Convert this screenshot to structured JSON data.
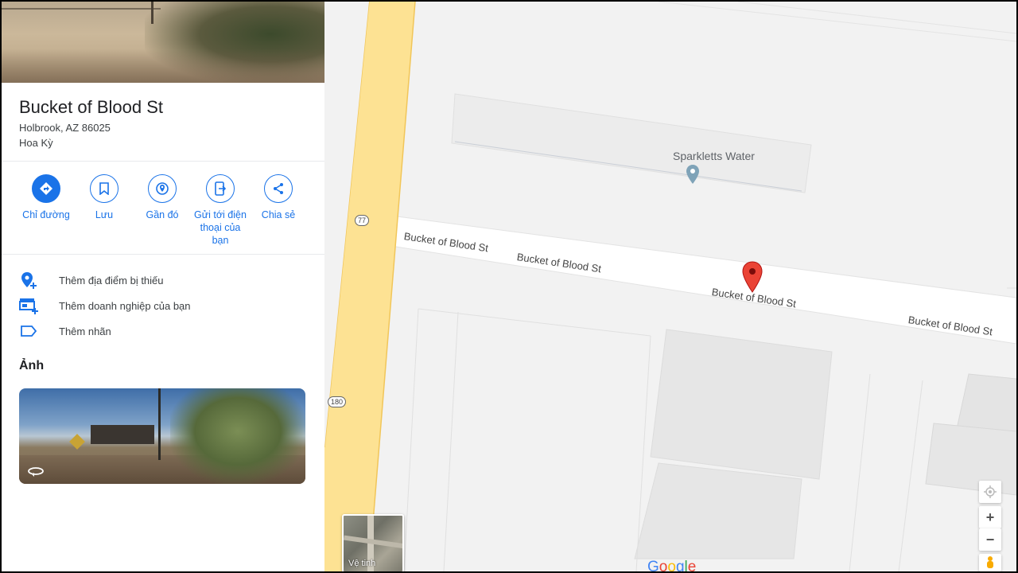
{
  "place": {
    "title": "Bucket of Blood St",
    "address_line1": "Holbrook, AZ 86025",
    "address_line2": "Hoa Kỳ"
  },
  "actions": [
    {
      "label": "Chỉ đường",
      "icon": "directions-icon"
    },
    {
      "label": "Lưu",
      "icon": "bookmark-icon"
    },
    {
      "label": "Gần đó",
      "icon": "nearby-icon"
    },
    {
      "label": "Gửi tới điện thoại của bạn",
      "icon": "send-to-phone-icon"
    },
    {
      "label": "Chia sẻ",
      "icon": "share-icon"
    }
  ],
  "rows": [
    {
      "label": "Thêm địa điểm bị thiếu",
      "icon": "add-location-icon"
    },
    {
      "label": "Thêm doanh nghiệp của bạn",
      "icon": "add-business-icon"
    },
    {
      "label": "Thêm nhãn",
      "icon": "label-icon"
    }
  ],
  "photos_heading": "Ảnh",
  "map": {
    "road_labels": [
      "Bucket of Blood St",
      "Bucket of Blood St",
      "Bucket of Blood St",
      "Bucket of Blood St"
    ],
    "poi_label": "Sparkletts Water",
    "shield_77": "77",
    "shield_180": "180",
    "satellite_label": "Vệ tinh",
    "logo": "Google",
    "zoom_in": "+",
    "zoom_out": "−"
  },
  "colors": {
    "accent": "#1a73e8",
    "highway": "#fde293",
    "marker": "#ea4335"
  }
}
